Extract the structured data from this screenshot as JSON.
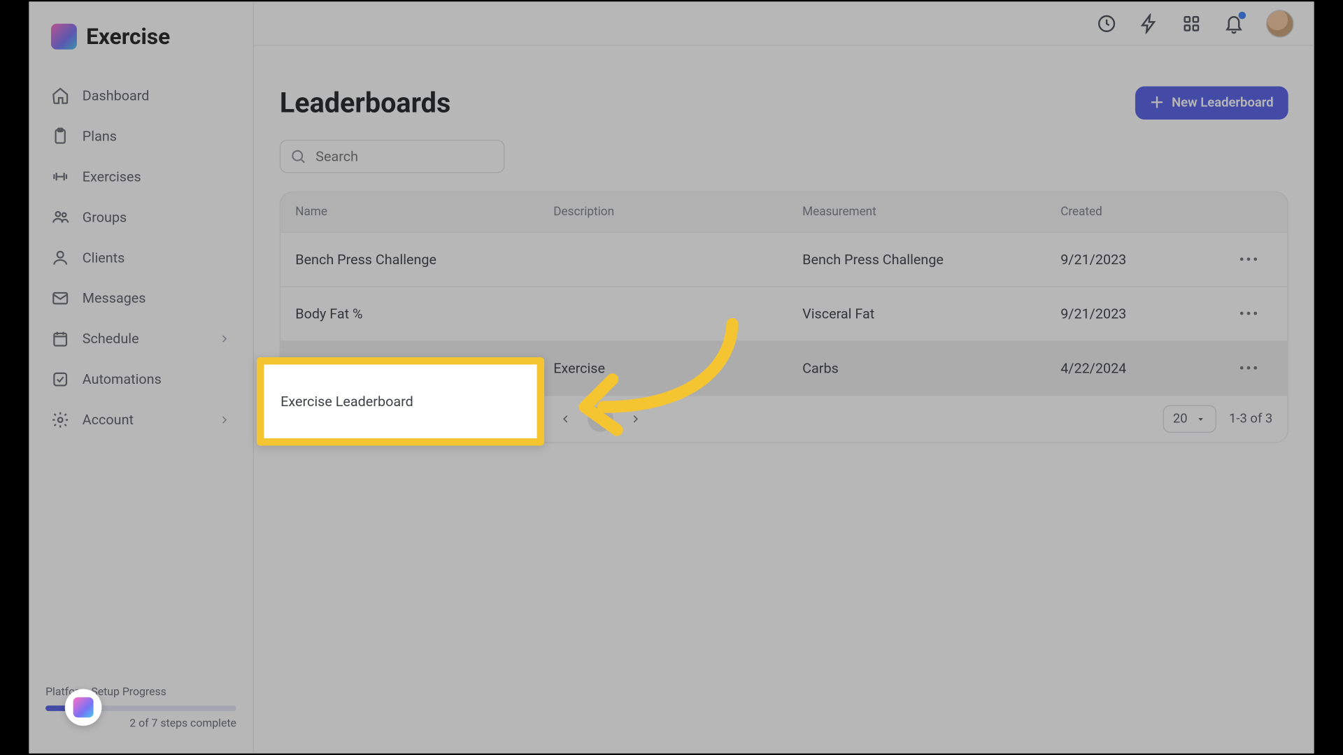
{
  "brand": {
    "name": "Exercise"
  },
  "sidebar": {
    "items": [
      {
        "label": "Dashboard"
      },
      {
        "label": "Plans"
      },
      {
        "label": "Exercises"
      },
      {
        "label": "Groups"
      },
      {
        "label": "Clients"
      },
      {
        "label": "Messages"
      },
      {
        "label": "Schedule",
        "expandable": true
      },
      {
        "label": "Automations"
      },
      {
        "label": "Account",
        "expandable": true
      }
    ],
    "setup": {
      "title": "Platform Setup Progress",
      "note": "2 of 7 steps complete"
    }
  },
  "page": {
    "title": "Leaderboards",
    "new_button": "New Leaderboard",
    "search_placeholder": "Search"
  },
  "table": {
    "columns": [
      "Name",
      "Description",
      "Measurement",
      "Created"
    ],
    "rows": [
      {
        "name": "Bench Press Challenge",
        "description": "",
        "measurement": "Bench Press Challenge",
        "created": "9/21/2023"
      },
      {
        "name": "Body Fat %",
        "description": "",
        "measurement": "Visceral Fat",
        "created": "9/21/2023"
      },
      {
        "name": "Exercise Leaderboard",
        "description": "Exercise",
        "measurement": "Carbs",
        "created": "4/22/2024"
      }
    ]
  },
  "pagination": {
    "current": "1",
    "page_size": "20",
    "range": "1-3 of 3"
  },
  "callout": {
    "label": "Exercise Leaderboard"
  }
}
